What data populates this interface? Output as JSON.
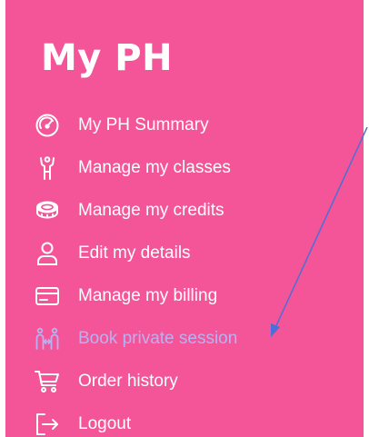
{
  "sidebar": {
    "title": "My PH",
    "background_color": "#f45598",
    "text_color": "#ffffff",
    "active_color": "#b9b1f2",
    "items": [
      {
        "label": "My PH Summary",
        "icon": "gauge-icon",
        "active": false
      },
      {
        "label": "Manage my classes",
        "icon": "person-raised-arms-icon",
        "active": false
      },
      {
        "label": "Manage my credits",
        "icon": "coin-stack-icon",
        "active": false
      },
      {
        "label": "Edit my details",
        "icon": "user-icon",
        "active": false
      },
      {
        "label": "Manage my billing",
        "icon": "credit-card-icon",
        "active": false
      },
      {
        "label": "Book private session",
        "icon": "two-people-icon",
        "active": true
      },
      {
        "label": "Order history",
        "icon": "shopping-cart-icon",
        "active": false
      },
      {
        "label": "Logout",
        "icon": "logout-icon",
        "active": false
      }
    ]
  },
  "annotation": {
    "arrow_color": "#4a6fd8"
  }
}
